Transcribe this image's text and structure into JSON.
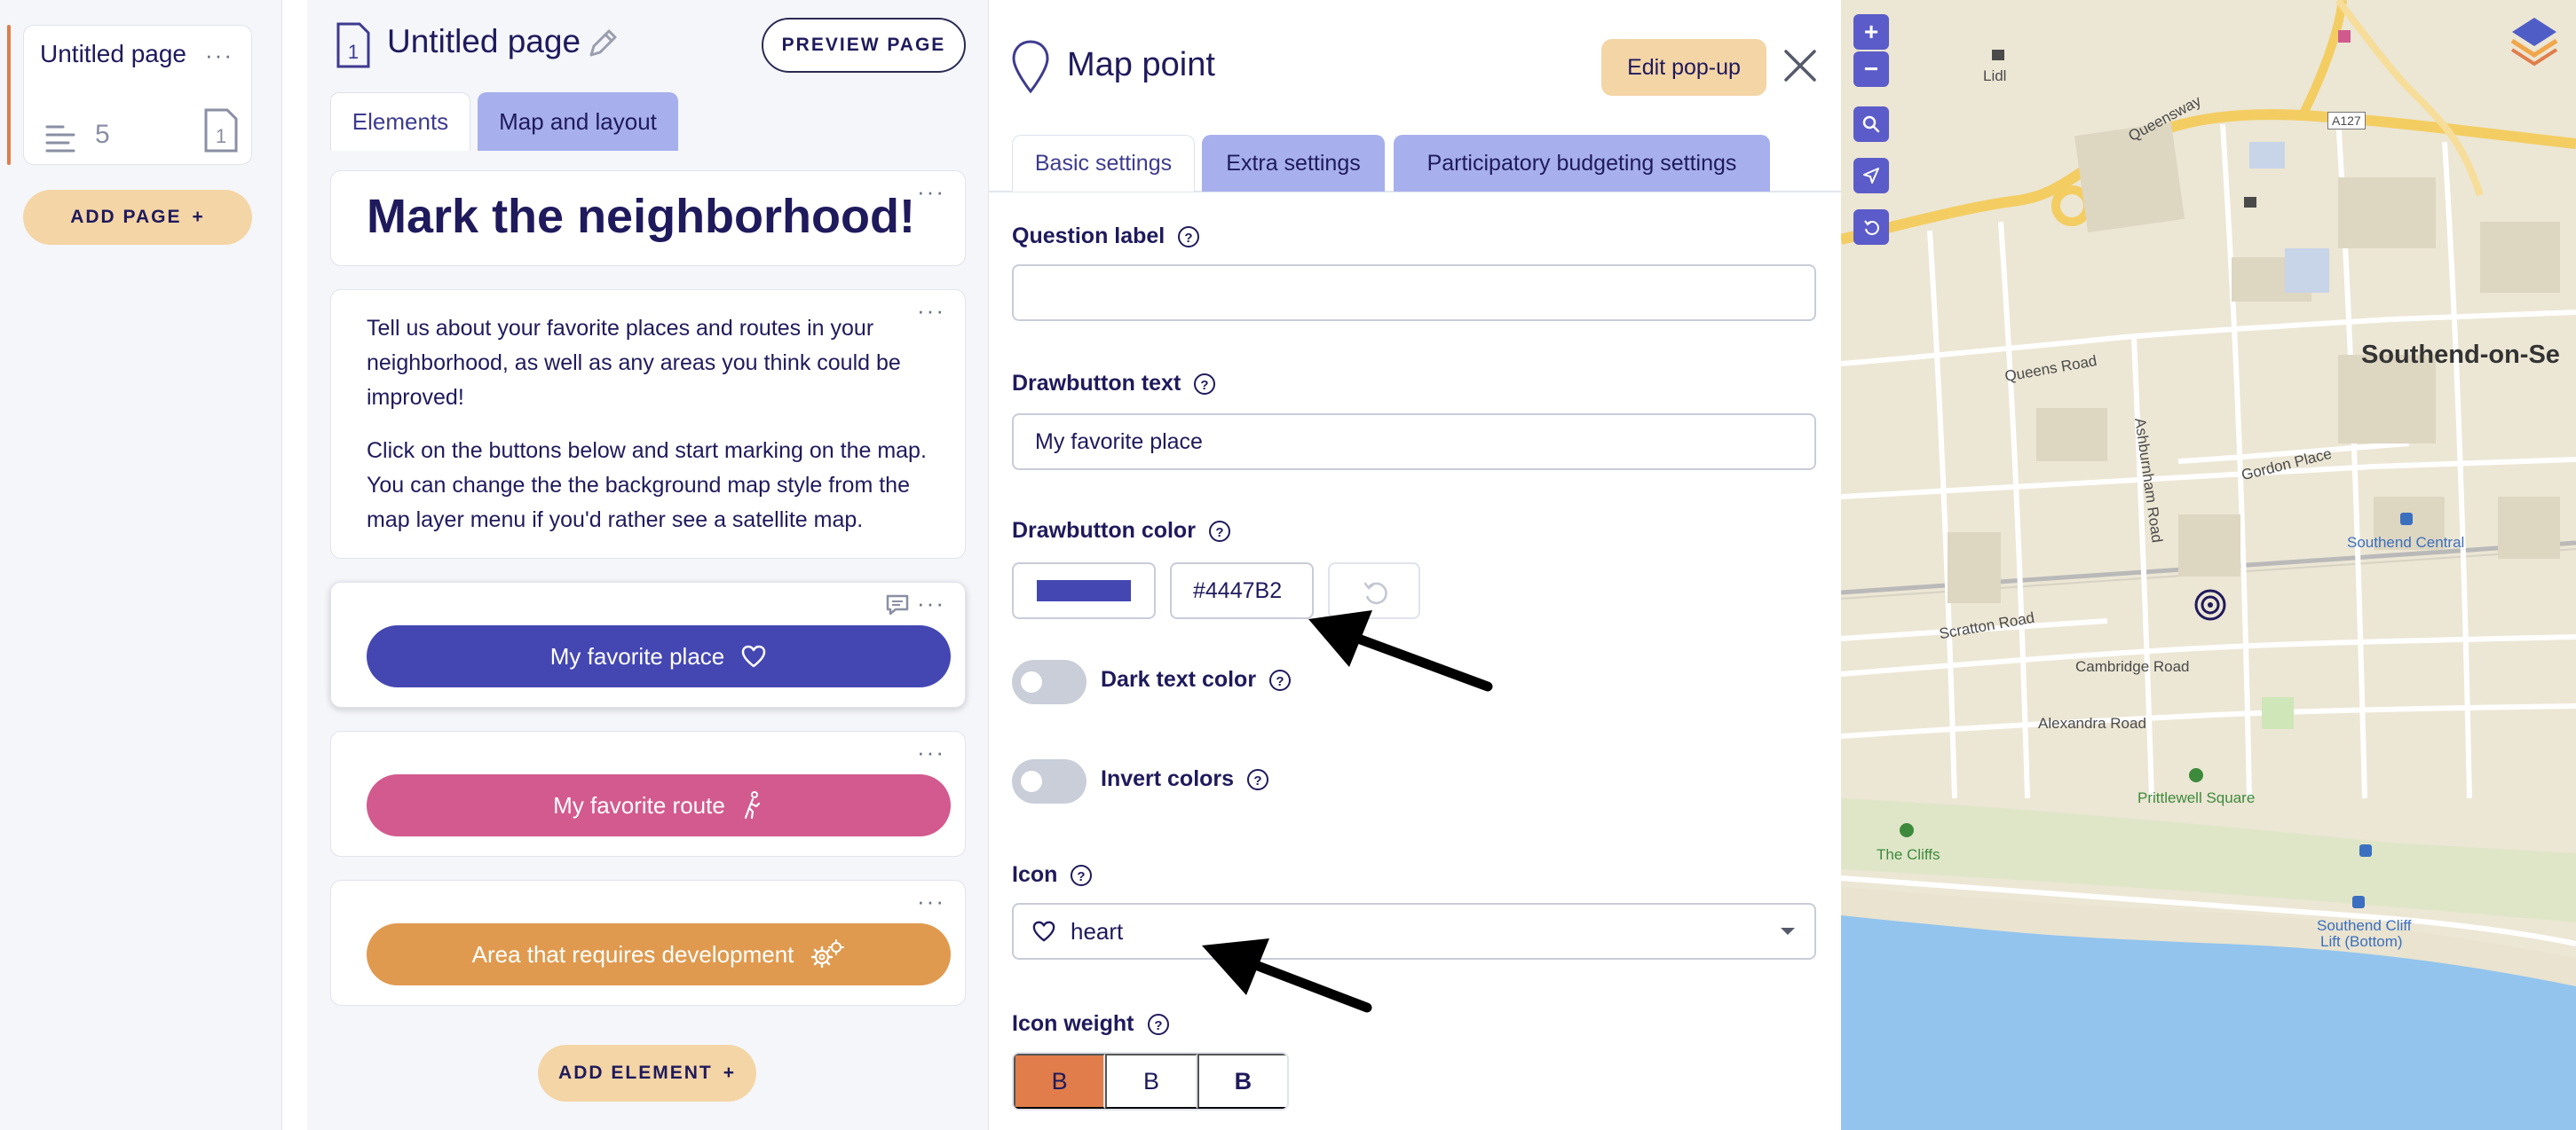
{
  "pages": {
    "items": [
      {
        "title": "Untitled page",
        "element_count": "5",
        "page_number": "1"
      }
    ],
    "add_page_label": "ADD PAGE"
  },
  "editor": {
    "page_title": "Untitled page",
    "preview_label": "PREVIEW PAGE",
    "tabs": [
      "Elements",
      "Map and layout"
    ],
    "heading": "Mark the neighborhood!",
    "paragraphs": [
      "Tell us about your favorite places and routes in your neighborhood, as well as any areas you think could be improved!",
      "Click on the buttons below and start marking on the map. You can change the the background map style from the map layer menu if you'd rather see a satellite map."
    ],
    "buttons": [
      {
        "label": "My favorite place",
        "color": "#4447B2",
        "icon": "heart-icon"
      },
      {
        "label": "My favorite route",
        "color": "#D35A8E",
        "icon": "walking-person-icon"
      },
      {
        "label": "Area that requires development",
        "color": "#DF9A4F",
        "icon": "gears-icon"
      }
    ],
    "add_element_label": "ADD ELEMENT"
  },
  "panel": {
    "title": "Map point",
    "edit_popup_label": "Edit pop-up",
    "tabs": [
      "Basic settings",
      "Extra settings",
      "Participatory budgeting settings"
    ],
    "question_label": {
      "label": "Question label",
      "value": ""
    },
    "drawbutton_text": {
      "label": "Drawbutton text",
      "value": "My favorite place"
    },
    "drawbutton_color": {
      "label": "Drawbutton color",
      "value": "#4447B2"
    },
    "dark_text_color": {
      "label": "Dark text color",
      "on": false
    },
    "invert_colors": {
      "label": "Invert colors",
      "on": false
    },
    "icon": {
      "label": "Icon",
      "value": "heart"
    },
    "icon_weight": {
      "label": "Icon weight",
      "options": [
        "B",
        "B",
        "B"
      ],
      "selected": 0
    }
  },
  "map": {
    "labels": [
      "Lidl",
      "Queensway",
      "A127",
      "Queens Road",
      "Ashburnham Road",
      "Gordon Place",
      "Southend-on-Se",
      "Southend Central",
      "Scratton Road",
      "Cambridge Road",
      "Alexandra Road",
      "Prittlewell Square",
      "The Cliffs",
      "Southend Cliff",
      "Lift (Bottom)"
    ],
    "zoom_in": "+",
    "zoom_out": "−"
  },
  "colors": {
    "navy": "#1F1A5C",
    "accent_orange": "#E07D4A",
    "tab_purple": "#A7B0EC",
    "pale_orange": "#F4D5A6"
  }
}
